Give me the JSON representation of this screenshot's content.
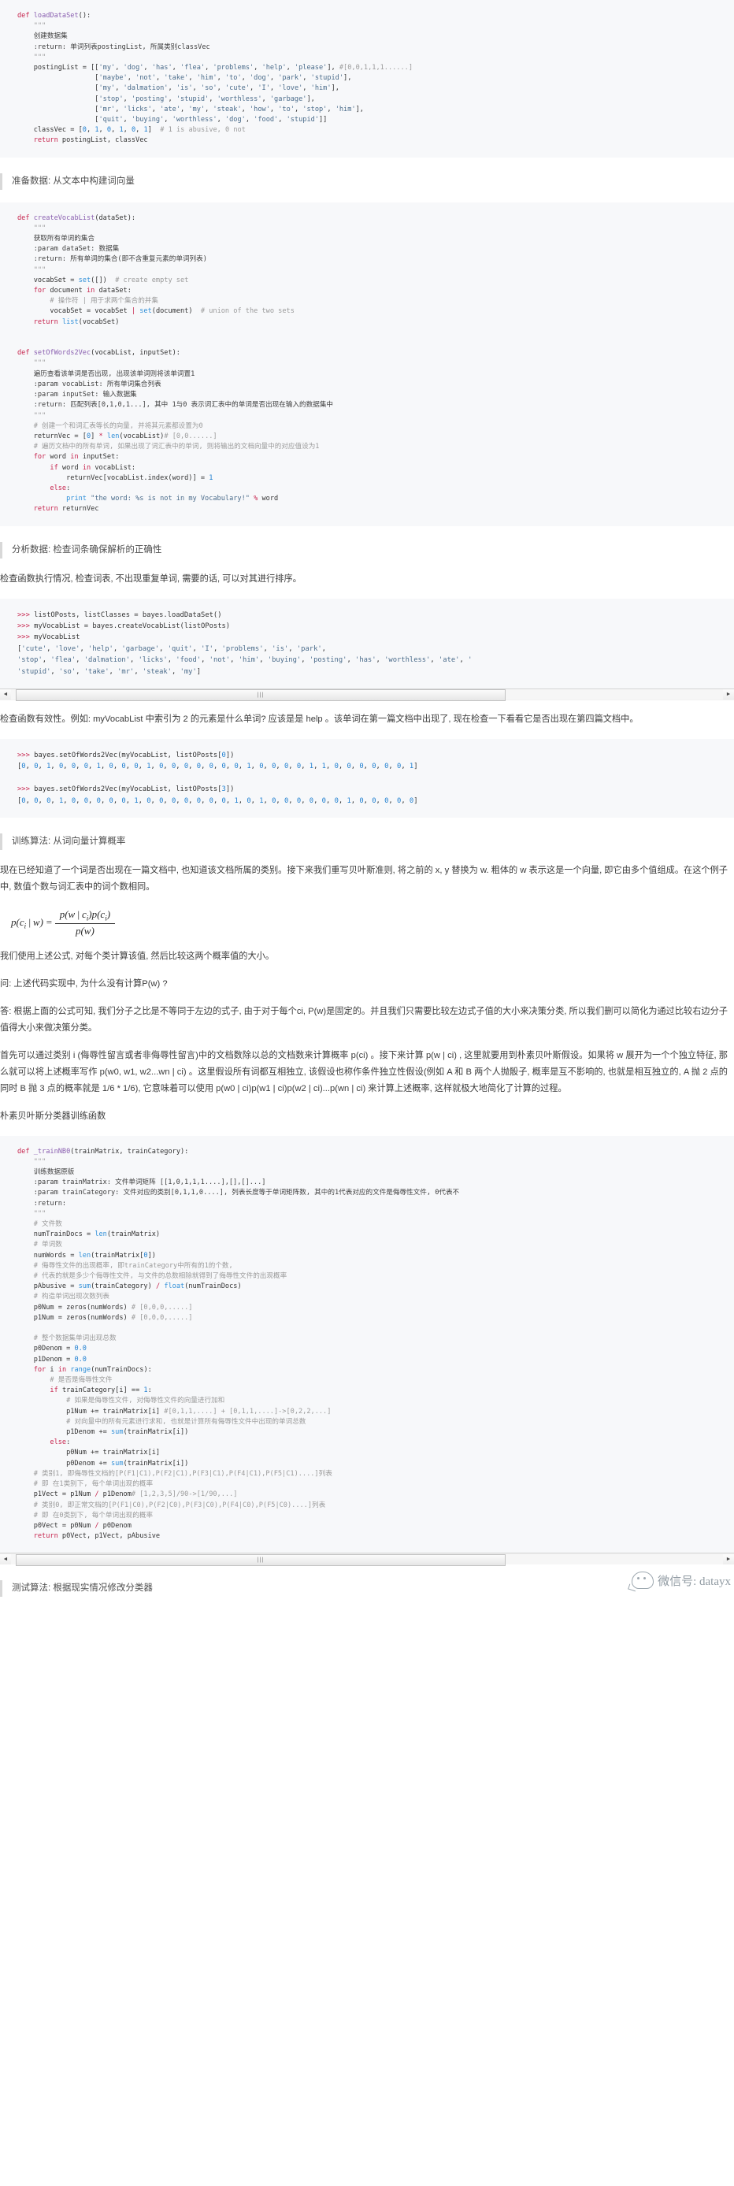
{
  "article": {
    "code_blocks": {
      "load_dataset": "def loadDataSet():\n    \"\"\"\n    创建数据集\n    :return: 单词列表postingList, 所属类别classVec\n    \"\"\"\n    postingList = [['my', 'dog', 'has', 'flea', 'problems', 'help', 'please'], #[0,0,1,1,1......]\n                   ['maybe', 'not', 'take', 'him', 'to', 'dog', 'park', 'stupid'],\n                   ['my', 'dalmation', 'is', 'so', 'cute', 'I', 'love', 'him'],\n                   ['stop', 'posting', 'stupid', 'worthless', 'garbage'],\n                   ['mr', 'licks', 'ate', 'my', 'steak', 'how', 'to', 'stop', 'him'],\n                   ['quit', 'buying', 'worthless', 'dog', 'food', 'stupid']]\n    classVec = [0, 1, 0, 1, 0, 1]  # 1 is abusive, 0 not\n    return postingList, classVec",
      "create_vocab": "def createVocabList(dataSet):\n    \"\"\"\n    获取所有单词的集合\n    :param dataSet: 数据集\n    :return: 所有单词的集合(即不含重复元素的单词列表)\n    \"\"\"\n    vocabSet = set([])  # create empty set\n    for document in dataSet:\n        # 操作符 | 用于求两个集合的并集\n        vocabSet = vocabSet | set(document)  # union of the two sets\n    return list(vocabSet)",
      "set_of_words": "def setOfWords2Vec(vocabList, inputSet):\n    \"\"\"\n    遍历查看该单词是否出现, 出现该单词则将该单词置1\n    :param vocabList: 所有单词集合列表\n    :param inputSet: 输入数据集\n    :return: 匹配列表[0,1,0,1...], 其中 1与0 表示词汇表中的单词是否出现在输入的数据集中\n    \"\"\"\n    # 创建一个和词汇表等长的向量, 并将其元素都设置为0\n    returnVec = [0] * len(vocabList)# [0,0......]\n    # 遍历文档中的所有单词, 如果出现了词汇表中的单词, 则将输出的文档向量中的对应值设为1\n    for word in inputSet:\n        if word in vocabList:\n            returnVec[vocabList.index(word)] = 1\n        else:\n            print \"the word: %s is not in my Vocabulary!\" % word\n    return returnVec",
      "repl_vocab": ">>> listOPosts, listClasses = bayes.loadDataSet()\n>>> myVocabList = bayes.createVocabList(listOPosts)\n>>> myVocabList\n['cute', 'love', 'help', 'garbage', 'quit', 'I', 'problems', 'is', 'park',\n'stop', 'flea', 'dalmation', 'licks', 'food', 'not', 'him', 'buying', 'posting', 'has', 'worthless', 'ate', '\n'stupid', 'so', 'take', 'mr', 'steak', 'my']",
      "repl_setwords": ">>> bayes.setOfWords2Vec(myVocabList, listOPosts[0])\n[0, 0, 1, 0, 0, 0, 1, 0, 0, 0, 1, 0, 0, 0, 0, 0, 0, 0, 1, 0, 0, 0, 0, 1, 1, 0, 0, 0, 0, 0, 0, 1]\n\n>>> bayes.setOfWords2Vec(myVocabList, listOPosts[3])\n[0, 0, 0, 1, 0, 0, 0, 0, 0, 1, 0, 0, 0, 0, 0, 0, 0, 1, 0, 1, 0, 0, 0, 0, 0, 0, 1, 0, 0, 0, 0, 0]",
      "train_nb0": "def _trainNB0(trainMatrix, trainCategory):\n    \"\"\"\n    训练数据原版\n    :param trainMatrix: 文件单词矩阵 [[1,0,1,1,1....],[],[]...]\n    :param trainCategory: 文件对应的类别[0,1,1,0....], 列表长度等于单词矩阵数, 其中的1代表对应的文件是侮辱性文件, 0代表不是侮辱性矩阵\n    :return:\n    \"\"\"\n    # 文件数\n    numTrainDocs = len(trainMatrix)\n    # 单词数\n    numWords = len(trainMatrix[0])\n    # 侮辱性文件的出现概率, 即trainCategory中所有的1的个数,\n    # 代表的就是多少个侮辱性文件, 与文件的总数相除就得到了侮辱性文件的出现概率\n    pAbusive = sum(trainCategory) / float(numTrainDocs)\n    # 构造单词出现次数列表\n    p0Num = zeros(numWords) # [0,0,0,.....]\n    p1Num = zeros(numWords) # [0,0,0,.....]\n\n    # 整个数据集单词出现总数\n    p0Denom = 0.0\n    p1Denom = 0.0\n    for i in range(numTrainDocs):\n        # 是否是侮辱性文件\n        if trainCategory[i] == 1:\n            # 如果是侮辱性文件, 对侮辱性文件的向量进行加和\n            p1Num += trainMatrix[i] #[0,1,1,....] + [0,1,1,....]->[0,2,2,...]\n            # 对向量中的所有元素进行求和, 也就是计算所有侮辱性文件中出现的单词总数\n            p1Denom += sum(trainMatrix[i])\n        else:\n            p0Num += trainMatrix[i]\n            p0Denom += sum(trainMatrix[i])\n    # 类别1, 即侮辱性文档的[P(F1|C1),P(F2|C1),P(F3|C1),P(F4|C1),P(F5|C1)....]列表\n    # 即 在1类别下, 每个单词出现的概率\n    p1Vect = p1Num / p1Denom# [1,2,3,5]/90->[1/90,...]\n    # 类别0, 即正常文档的[P(F1|C0),P(F2|C0),P(F3|C0),P(F4|C0),P(F5|C0)....]列表\n    # 即 在0类别下, 每个单词出现的概率\n    p0Vect = p0Num / p0Denom\n    return p0Vect, p1Vect, pAbusive"
    },
    "headings": {
      "prepare_data": "准备数据: 从文本中构建词向量",
      "analyze_data": "分析数据: 检查词条确保解析的正确性",
      "train_algorithm": "训练算法: 从词向量计算概率",
      "test_algorithm": "测试算法: 根据现实情况修改分类器"
    },
    "paragraphs": {
      "check_exec": "检查函数执行情况, 检查词表, 不出现重复单词, 需要的话, 可以对其进行排序。",
      "check_valid": "检查函数有效性。例如: myVocabList 中索引为 2 的元素是什么单词? 应该是是 help 。该单词在第一篇文档中出现了, 现在检查一下看看它是否出现在第四篇文档中。",
      "train_intro": "现在已经知道了一个词是否出现在一篇文档中, 也知道该文档所属的类别。接下来我们重写贝叶斯准则, 将之前的 x, y 替换为 w. 粗体的 w 表示这是一个向量, 即它由多个值组成。在这个例子中, 数值个数与词汇表中的词个数相同。",
      "use_formula": "我们使用上述公式, 对每个类计算该值, 然后比较这两个概率值的大小。",
      "question": "问: 上述代码实现中, 为什么没有计算P(w) ?",
      "answer": "答: 根据上面的公式可知, 我们分子之比是不等同于左边的式子, 由于对于每个ci, P(w)是固定的。并且我们只需要比较左边式子值的大小来决策分类, 所以我们删可以简化为通过比较右边分子值得大小来做决策分类。",
      "explain1": "首先可以通过类别 i (侮辱性留言或者非侮辱性留言)中的文档数除以总的文档数来计算概率 p(ci) 。接下来计算 p(w | ci) , 这里就要用到朴素贝叶斯假设。如果将 w 展开为一个个独立特征, 那么就可以将上述概率写作 p(w0, w1, w2...wn | ci) 。这里假设所有词都互相独立, 该假设也称作条件独立性假设(例如 A 和 B 两个人抛骰子, 概率是互不影响的, 也就是相互独立的, A 抛 2 点的同时 B 抛 3 点的概率就是 1/6 * 1/6), 它意味着可以使用 p(w0 | ci)p(w1 | ci)p(w2 | ci)...p(wn | ci) 来计算上述概率, 这样就极大地简化了计算的过程。",
      "train_func_title": "朴素贝叶斯分类器训练函数"
    },
    "formula": {
      "lhs_p": "p",
      "lhs_c": "c",
      "lhs_i": "i",
      "lhs_bar": "|",
      "lhs_w": "w",
      "eq": "=",
      "num_1": "p(w | c",
      "num_sub": "i",
      "num_2": ")p(c",
      "num_sub2": "i",
      "num_3": ")",
      "den": "p(w)"
    },
    "scrollbar": {
      "left_arrow": "◄",
      "right_arrow": "►",
      "grip": "|||"
    },
    "footer": {
      "brand_text": "微信号: datayx",
      "ghost_icon": "ghost-mascot-icon"
    }
  }
}
